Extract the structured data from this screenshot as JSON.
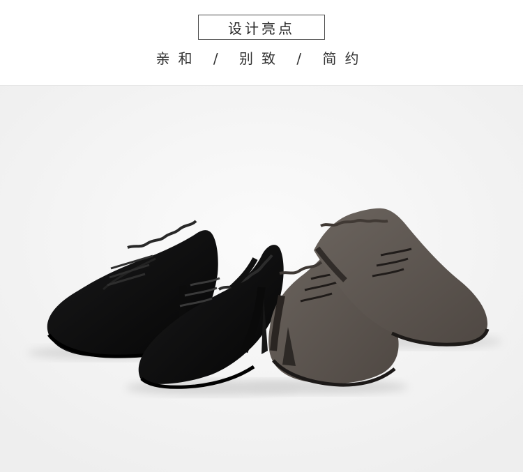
{
  "header": {
    "title": "设计亮点"
  },
  "subtitle": {
    "text": "亲和 / 别致 / 简约"
  },
  "hero_image": {
    "shoes": [
      {
        "color_name": "black",
        "color": "#0f0f10"
      },
      {
        "color_name": "gray-brown",
        "color": "#5f5751"
      }
    ]
  }
}
